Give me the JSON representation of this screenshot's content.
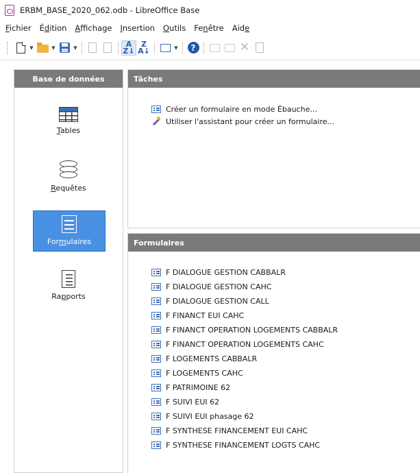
{
  "window": {
    "title": "ERBM_BASE_2020_062.odb - LibreOffice Base"
  },
  "menubar": [
    {
      "pre": "",
      "acc": "F",
      "post": "ichier"
    },
    {
      "pre": "É",
      "acc": "d",
      "post": "ition"
    },
    {
      "pre": "",
      "acc": "A",
      "post": "ffichage"
    },
    {
      "pre": "",
      "acc": "I",
      "post": "nsertion"
    },
    {
      "pre": "",
      "acc": "O",
      "post": "utils"
    },
    {
      "pre": "Fe",
      "acc": "n",
      "post": "être"
    },
    {
      "pre": "Aid",
      "acc": "e",
      "post": ""
    }
  ],
  "toolbar": {
    "icons": [
      "new-document-icon",
      "open-folder-icon",
      "save-icon",
      "copy-icon",
      "paste-icon",
      "sort-ascending-icon",
      "sort-descending-icon",
      "form-view-icon",
      "help-icon",
      "edit-icon",
      "rename-icon",
      "delete-icon",
      "properties-icon"
    ]
  },
  "left_panel": {
    "header": "Base de données",
    "items": [
      {
        "pre": "",
        "acc": "T",
        "post": "ables",
        "icon": "table-icon"
      },
      {
        "pre": "",
        "acc": "R",
        "post": "equêtes",
        "icon": "database-icon"
      },
      {
        "pre": "For",
        "acc": "m",
        "post": "ulaires",
        "icon": "form-icon",
        "selected": true
      },
      {
        "pre": "Ra",
        "acc": "p",
        "post": "ports",
        "icon": "report-icon"
      }
    ]
  },
  "tasks": {
    "header": "Tâches",
    "items": [
      {
        "label": "Créer un formulaire en mode Ébauche...",
        "icon": "form-icon"
      },
      {
        "label": "Utiliser l'assistant pour créer un formulaire...",
        "icon": "wizard-icon"
      }
    ]
  },
  "forms": {
    "header": "Formulaires",
    "items": [
      "F DIALOGUE GESTION CABBALR",
      "F DIALOGUE GESTION CAHC",
      "F DIALOGUE GESTION CALL",
      "F FINANCT EUI CAHC",
      "F FINANCT OPERATION LOGEMENTS CABBALR",
      "F FINANCT OPERATION LOGEMENTS CAHC",
      "F LOGEMENTS CABBALR",
      "F LOGEMENTS CAHC",
      "F PATRIMOINE 62",
      "F SUIVI EUI 62",
      "F SUIVI EUI phasage 62",
      "F SYNTHESE FINANCEMENT EUI CAHC",
      "F SYNTHESE FINANCEMENT LOGTS CAHC"
    ]
  },
  "colors": {
    "header_bg": "#7a7a7a",
    "selected_bg": "#4a90e2",
    "accent": "#3c6fb5",
    "app_icon": "#a23399"
  }
}
